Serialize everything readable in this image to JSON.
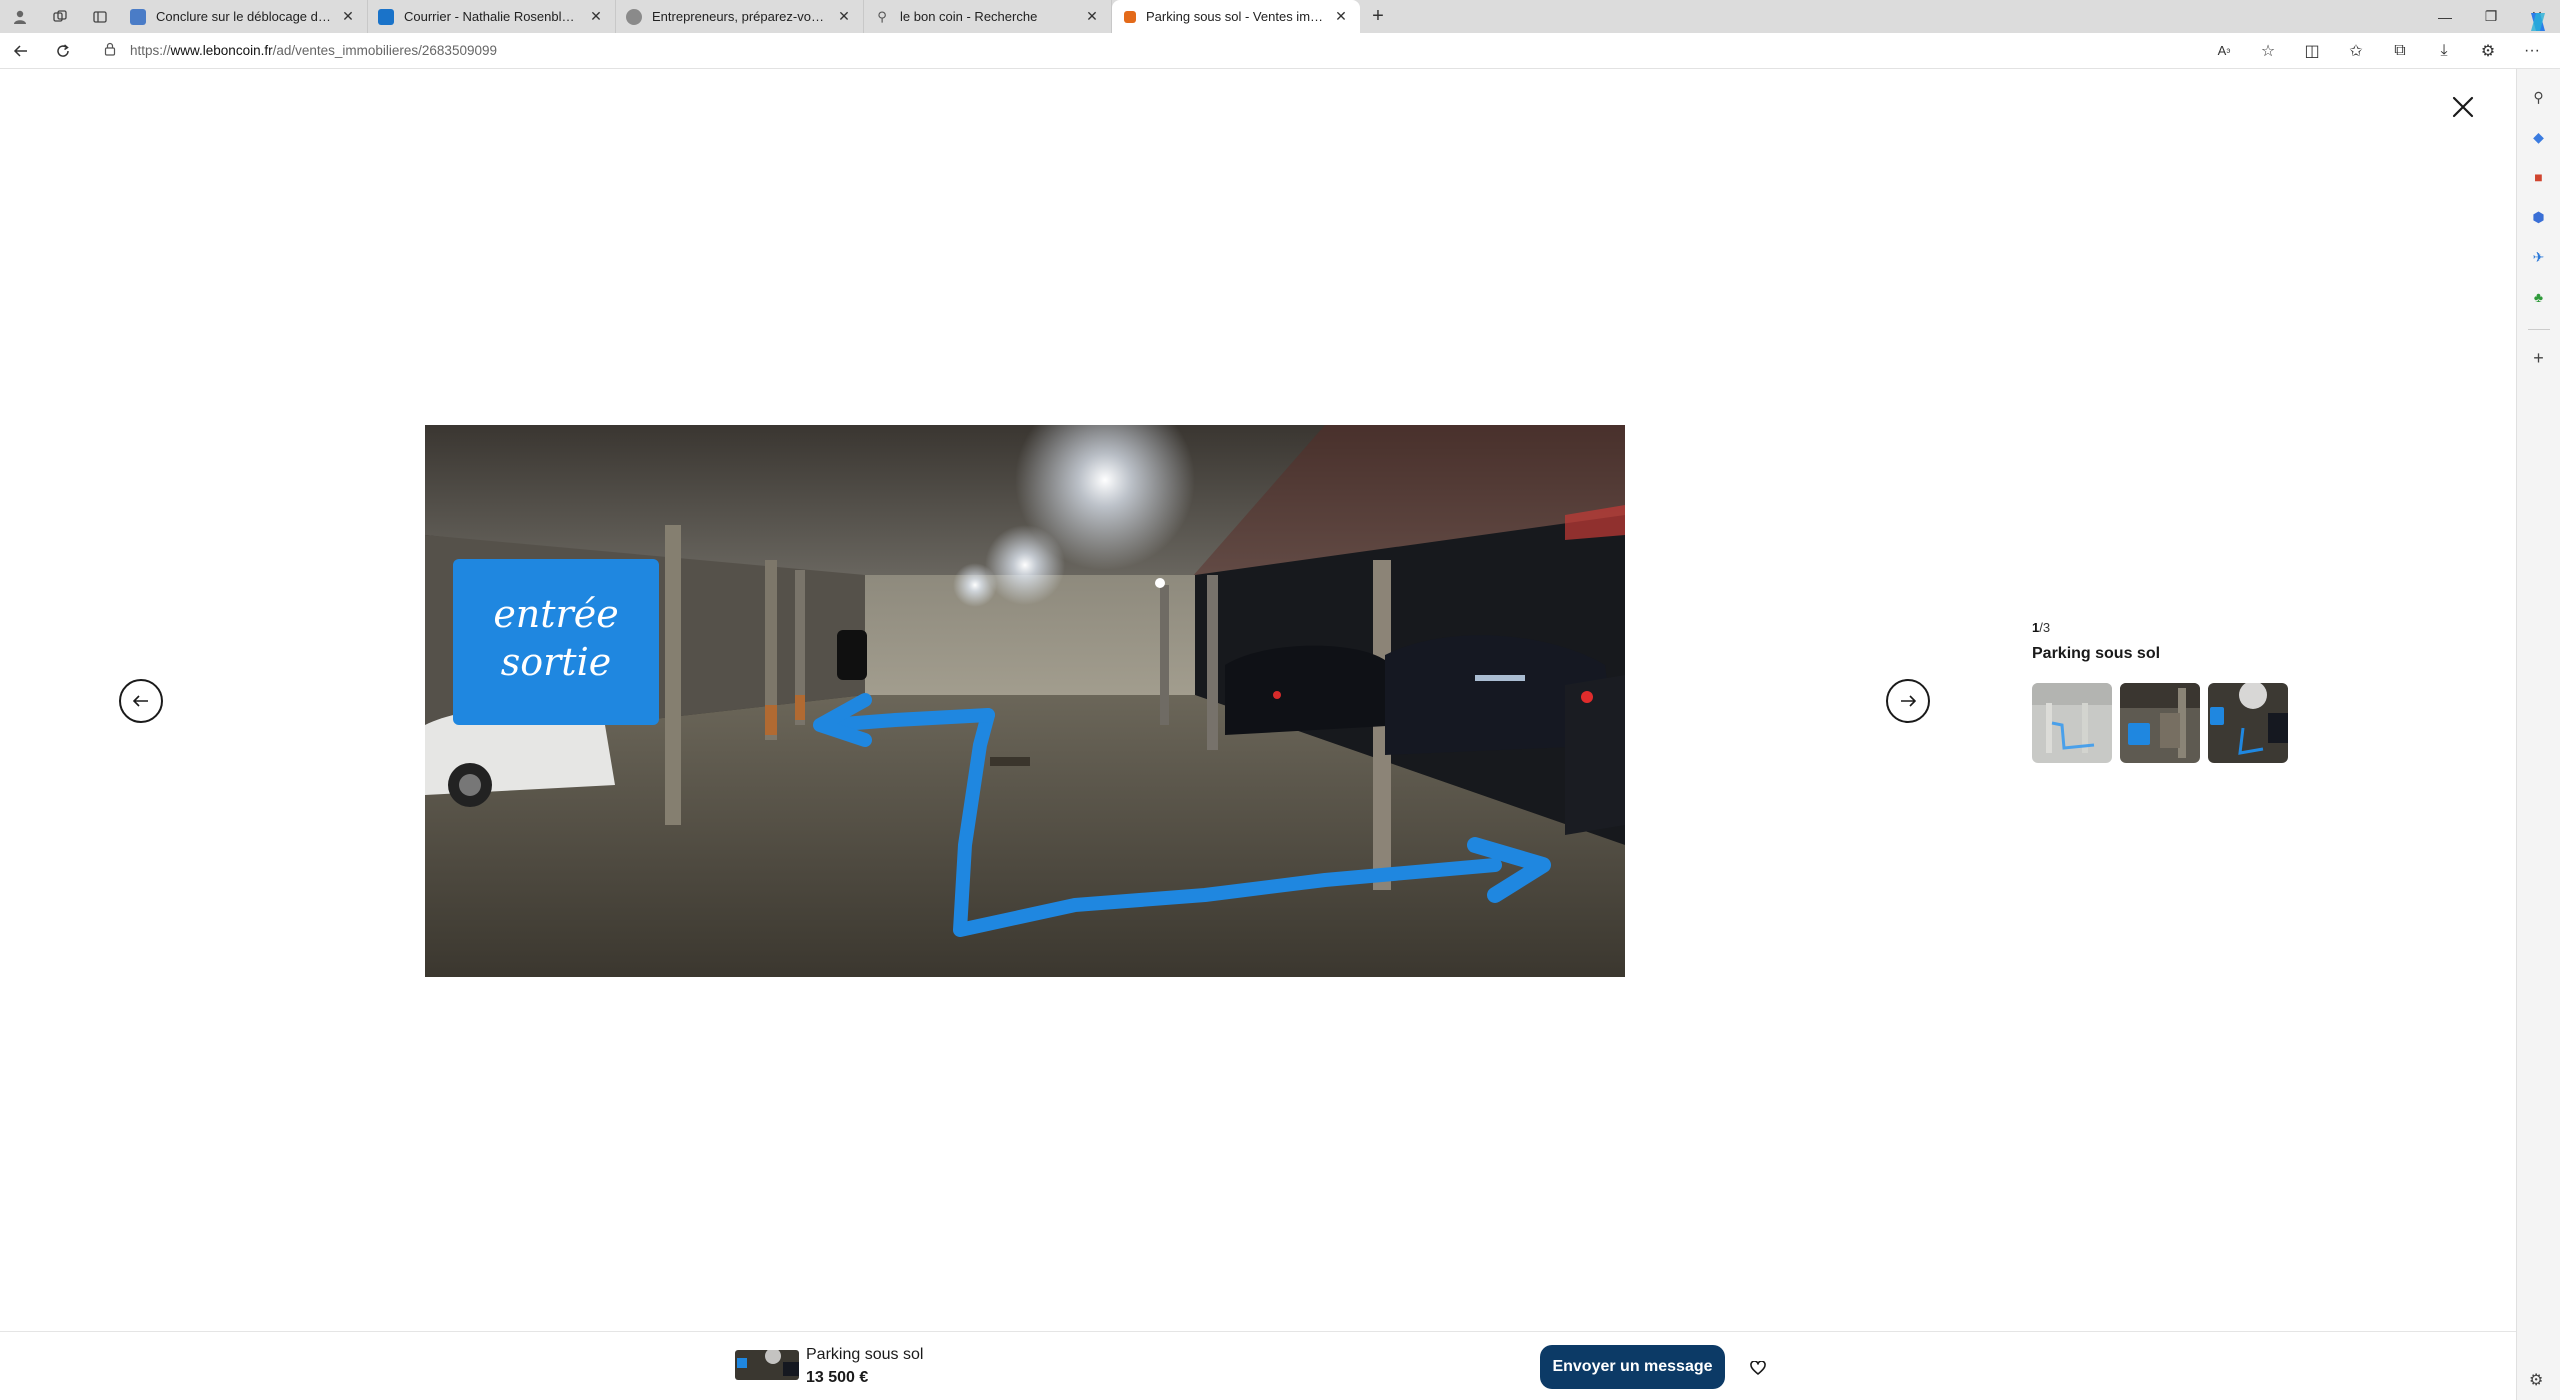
{
  "browser": {
    "tabs": [
      {
        "title": "Conclure sur le déblocage de la c",
        "favicon_color": "#4a7cc7",
        "active": false
      },
      {
        "title": "Courrier - Nathalie Rosenblatt - C",
        "favicon_color": "#1a73c9",
        "active": false
      },
      {
        "title": "Entrepreneurs, préparez-vous à la",
        "favicon_color": "#8a8a8a",
        "active": false
      },
      {
        "title": "le bon coin - Recherche",
        "favicon_color": "#6b6b6b",
        "active": false
      },
      {
        "title": "Parking sous sol - Ventes immob",
        "favicon_color": "#e36a1a",
        "active": true
      }
    ],
    "url": {
      "scheme": "https://",
      "host": "www.leboncoin.fr",
      "path": "/ad/ventes_immobilieres/2683509099"
    }
  },
  "viewer": {
    "photo_overlay_text": [
      "entrée",
      "sortie"
    ],
    "counter_current": "1",
    "counter_total": "/3",
    "photo_title": "Parking sous sol",
    "thumbnails": [
      "thumb-1",
      "thumb-2",
      "thumb-3"
    ]
  },
  "bottom_bar": {
    "title": "Parking sous sol",
    "price": "13 500 €",
    "message_button": "Envoyer un message"
  },
  "colors": {
    "primary_button": "#0c3a66",
    "accent_blue": "#1f87e0"
  }
}
